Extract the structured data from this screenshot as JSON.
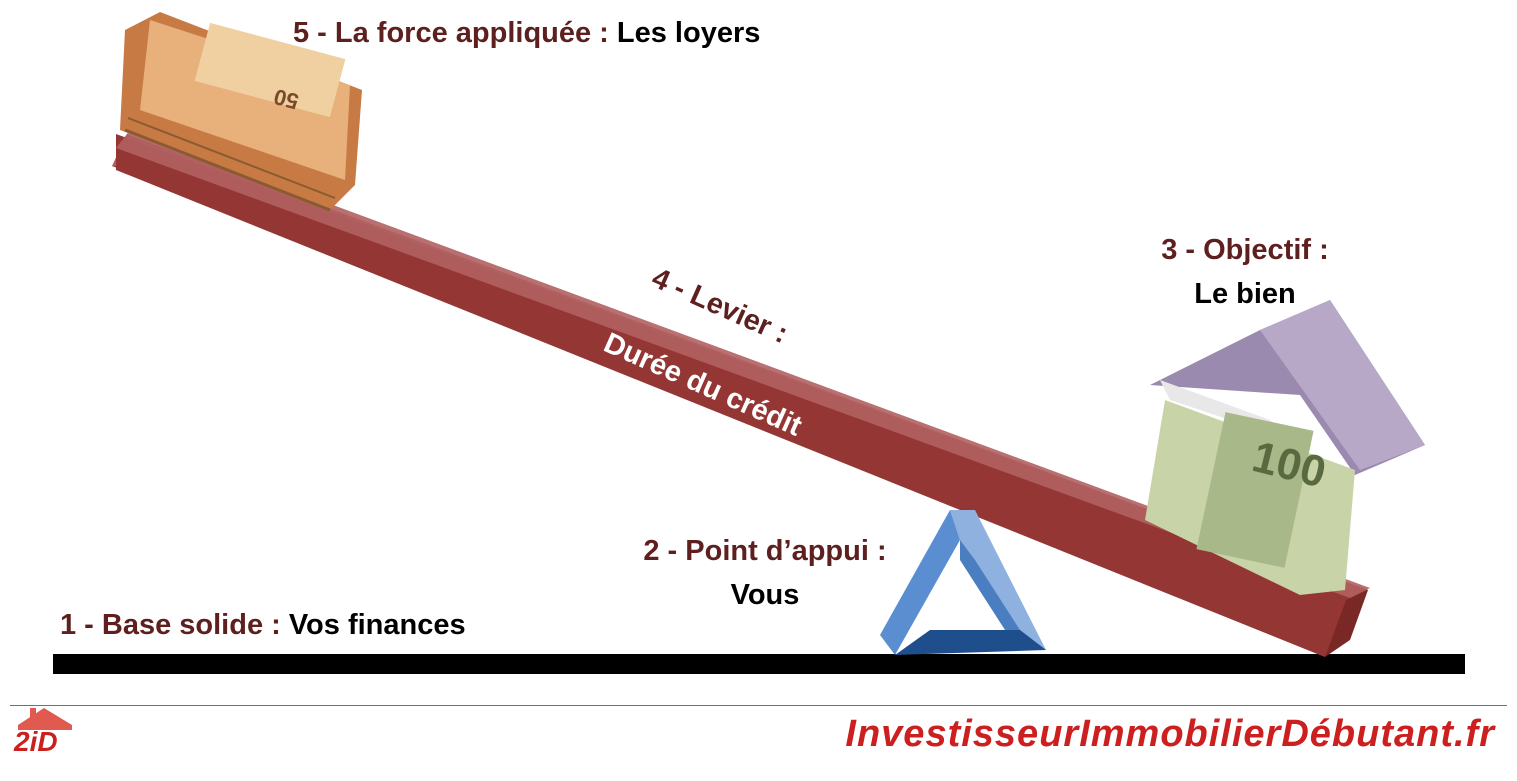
{
  "labels": {
    "force": {
      "prefix": "5 - La force appliquée : ",
      "value": "Les loyers"
    },
    "lever": {
      "prefix": "4 - Levier :",
      "value": "Durée du crédit"
    },
    "objective": {
      "prefix": "3 - Objectif  :",
      "value": "Le bien"
    },
    "fulcrum": {
      "prefix": "2 - Point d’appui :",
      "value": "Vous"
    },
    "base": {
      "prefix": "1 - Base solide : ",
      "value": "Vos finances"
    }
  },
  "footer": {
    "site": "InvestisseurImmobilierDébutant.fr",
    "logo_text": "2iD"
  },
  "colors": {
    "lever": "#943634",
    "lever_top": "#b06060",
    "label": "#5e1f1f",
    "fulcrum_light": "#8fb1e0",
    "fulcrum_dark": "#1f4e8c",
    "brand": "#cc1f1f"
  }
}
